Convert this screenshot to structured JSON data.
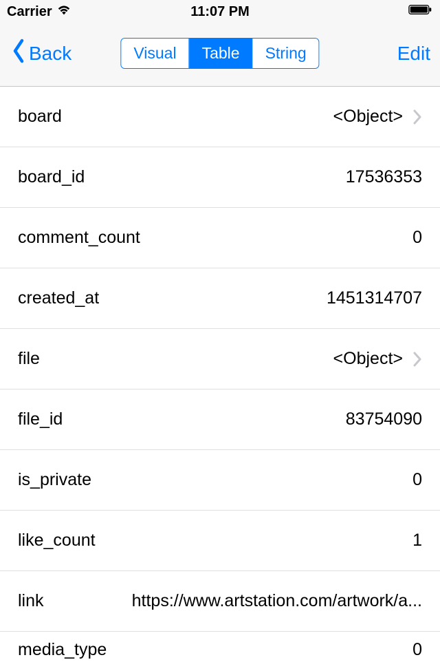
{
  "status_bar": {
    "carrier": "Carrier",
    "time": "11:07 PM"
  },
  "nav": {
    "back_label": "Back",
    "edit_label": "Edit",
    "segments": {
      "visual": "Visual",
      "table": "Table",
      "string": "String"
    }
  },
  "rows": [
    {
      "key": "board",
      "value": "<Object>",
      "disclosure": true
    },
    {
      "key": "board_id",
      "value": "17536353",
      "disclosure": false
    },
    {
      "key": "comment_count",
      "value": "0",
      "disclosure": false
    },
    {
      "key": "created_at",
      "value": "1451314707",
      "disclosure": false
    },
    {
      "key": "file",
      "value": "<Object>",
      "disclosure": true
    },
    {
      "key": "file_id",
      "value": "83754090",
      "disclosure": false
    },
    {
      "key": "is_private",
      "value": "0",
      "disclosure": false
    },
    {
      "key": "like_count",
      "value": "1",
      "disclosure": false
    },
    {
      "key": "link",
      "value": "https://www.artstation.com/artwork/a...",
      "disclosure": false
    }
  ],
  "partial_row": {
    "key": "media_type",
    "value": "0"
  }
}
